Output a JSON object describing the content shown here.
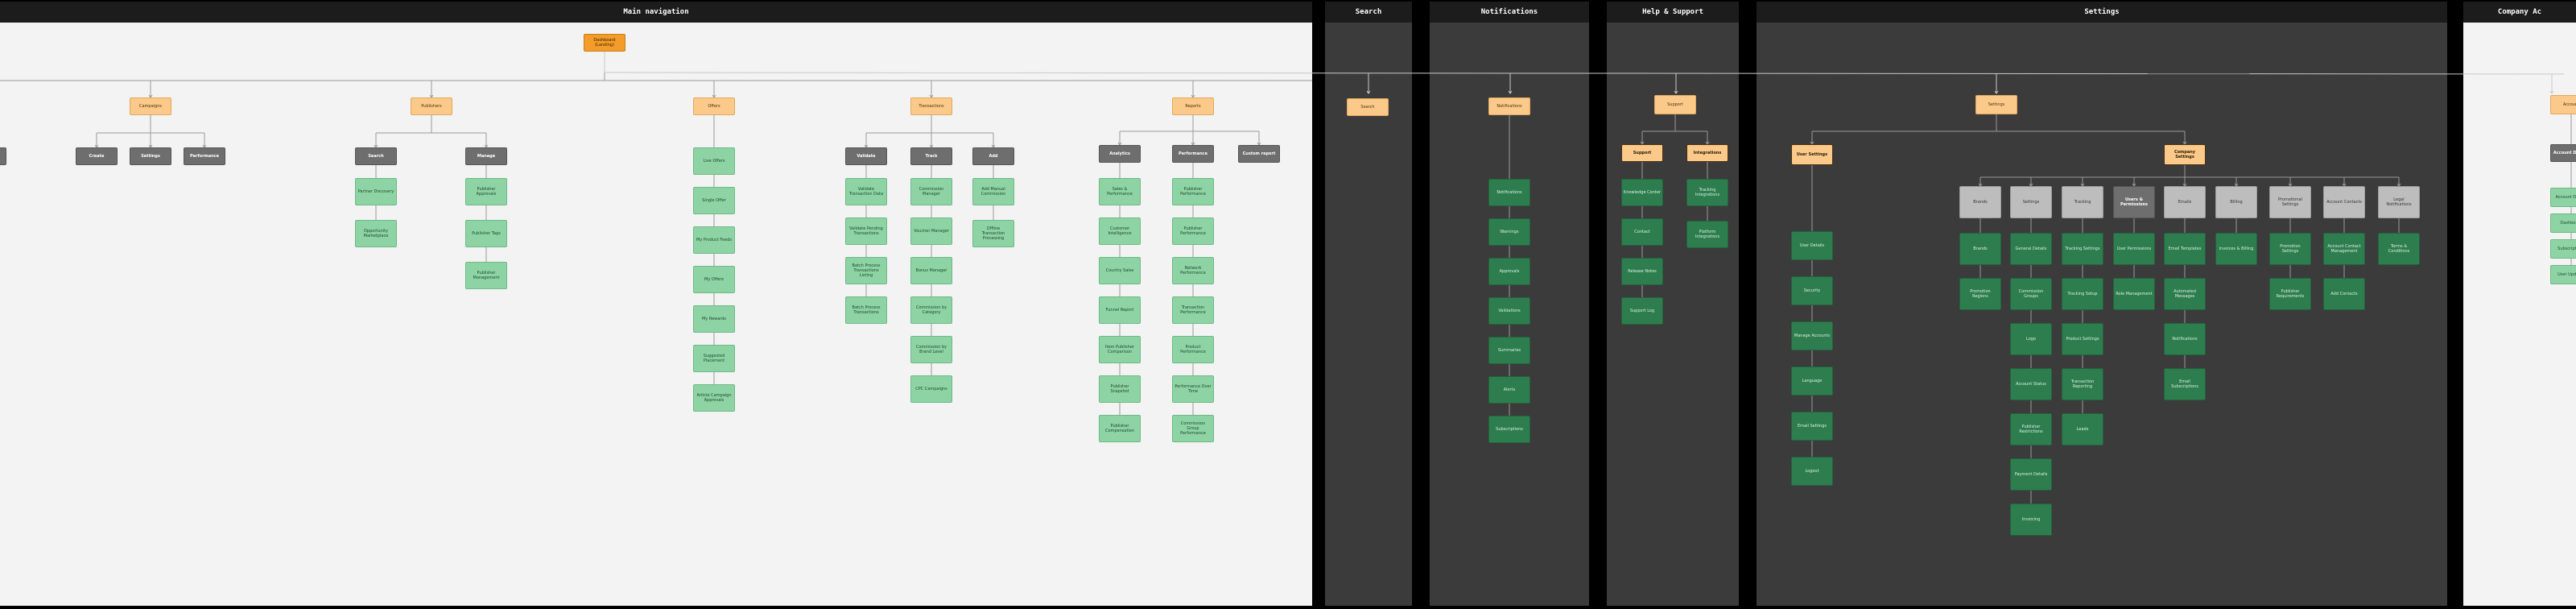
{
  "panels": {
    "main": "Main navigation",
    "search": "Search",
    "notifications": "Notifications",
    "help": "Help & Support",
    "settings": "Settings",
    "company": "Company Ac"
  },
  "main": {
    "root": "Dashboard (Landing)",
    "sections": [
      "Campaigns",
      "Publishers",
      "Offers",
      "Transactions",
      "Reports"
    ],
    "campaign_groups": [
      "Create",
      "Settings",
      "Performance"
    ],
    "publisher_groups": [
      "Search",
      "Manage"
    ],
    "publisher_search_items": [
      "Partner Discovery",
      "Opportunity Marketplace"
    ],
    "publisher_manage_items": [
      "Publisher Approvals",
      "Publisher Tags",
      "Publisher Management"
    ],
    "offer_items": [
      "Live Offers",
      "Single Offer",
      "My Product Feeds",
      "My Offers",
      "My Rewards",
      "Suggested Placement",
      "Article Campaign Approvals"
    ],
    "transaction_groups": [
      "Validate",
      "Track",
      "Add"
    ],
    "validate_items": [
      "Validate Transaction Data",
      "Validate Pending Transactions",
      "Batch Process Transactions Listing",
      "Batch Process Transactions"
    ],
    "track_items": [
      "Commission Manager",
      "Voucher Manager",
      "Bonus Manager",
      "Commission by Category",
      "Commission by Brand Level",
      "CPC Campaigns"
    ],
    "add_items": [
      "Add Manual Commission",
      "Offline Transaction Processing"
    ],
    "report_groups": [
      "Analytics",
      "Performance",
      "Custom report"
    ],
    "analytics_items": [
      "Sales & Performance",
      "Customer Intelligence",
      "Country Sales",
      "Funnel Report",
      "Item Publisher Comparison",
      "Publisher Snapshot",
      "Publisher Compensation"
    ],
    "performance_items": [
      "Publisher Performance",
      "Publisher Performance",
      "Network Performance",
      "Transaction Performance",
      "Product Performance",
      "Performance Over Time",
      "Commission Group Performance"
    ]
  },
  "search": {
    "item": "Search"
  },
  "notifications": {
    "root": "Notifications",
    "items": [
      "Notifications",
      "Warnings",
      "Approvals",
      "Validations",
      "Summaries",
      "Alerts",
      "Subscriptions"
    ]
  },
  "help": {
    "root": "Support",
    "groups": [
      "Support",
      "Integrations"
    ],
    "support_items": [
      "Knowledge Center",
      "Contact",
      "Release Notes",
      "Support Log"
    ],
    "integration_items": [
      "Tracking Integrations",
      "Platform Integrations"
    ]
  },
  "settings": {
    "root": "Settings",
    "groups": [
      "User Settings",
      "Company Settings"
    ],
    "user_items": [
      "User Details",
      "Security",
      "Manage Accounts",
      "Language",
      "Email Settings",
      "Logout"
    ],
    "company_groups": [
      "Brands",
      "Settings",
      "Tracking",
      "Users & Permissions",
      "Emails",
      "Billing",
      "Promotional Settings",
      "Account Contacts",
      "Legal Notifications"
    ],
    "brands_items": [
      "Brands",
      "Promotion Regions"
    ],
    "settings_items": [
      "General Details",
      "Commission Groups",
      "Logo",
      "Account Status",
      "Publisher Restrictions",
      "Payment Details",
      "Invoicing"
    ],
    "tracking_items": [
      "Tracking Settings",
      "Tracking Setup",
      "Product Settings",
      "Transaction Reporting",
      "Leads"
    ],
    "users_items": [
      "User Permissions",
      "Role Management"
    ],
    "emails_items": [
      "Email Templates",
      "Automated Messages",
      "Notifications",
      "Email Subscriptions"
    ],
    "billing_items": [
      "Invoices & Billing"
    ],
    "promo_items": [
      "Promotion Settings",
      "Publisher Requirements"
    ],
    "contacts_items": [
      "Account Contact Management",
      "Add Contacts"
    ],
    "legal_items": [
      "Terms & Conditions"
    ]
  },
  "company": {
    "root": "Account",
    "group": "Account Details",
    "items": [
      "Account Details",
      "Dashboard",
      "Subscriptions",
      "User Updates"
    ]
  },
  "colors": {
    "root": "#f39c2a",
    "section": "#fbc98a",
    "group": "#6e6e6e",
    "leaf_light": "#8ed3a4",
    "leaf_dark": "#2e7d4f",
    "panel_light": "#f3f3f3",
    "panel_dark": "#3b3b3b"
  }
}
